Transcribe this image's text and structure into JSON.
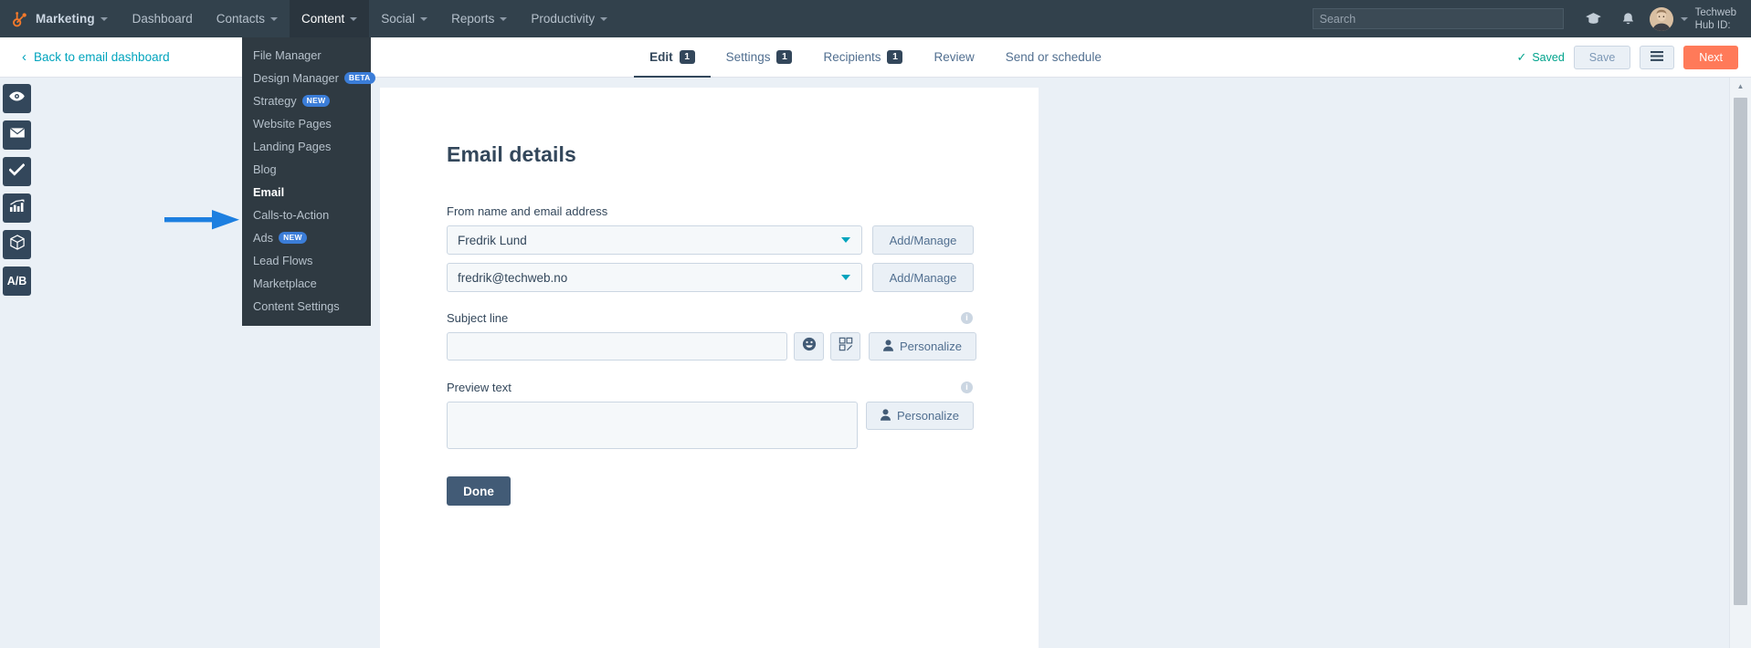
{
  "topnav": {
    "logo_icon": "hubspot-sprocket-icon",
    "logo_label": "Marketing",
    "items": [
      {
        "label": "Dashboard",
        "has_caret": false,
        "active": false
      },
      {
        "label": "Contacts",
        "has_caret": true,
        "active": false
      },
      {
        "label": "Content",
        "has_caret": true,
        "active": true
      },
      {
        "label": "Social",
        "has_caret": true,
        "active": false
      },
      {
        "label": "Reports",
        "has_caret": true,
        "active": false
      },
      {
        "label": "Productivity",
        "has_caret": true,
        "active": false
      }
    ],
    "search": {
      "value": "",
      "placeholder": "Search"
    },
    "icons": [
      "graduation-cap-icon",
      "notification-bell-icon"
    ],
    "account_name": "Techweb",
    "account_hub_label": "Hub ID:"
  },
  "content_dropdown": {
    "open": true,
    "items": [
      {
        "label": "File Manager",
        "badge": "",
        "active": false
      },
      {
        "label": "Design Manager",
        "badge": "BETA",
        "active": false
      },
      {
        "label": "Strategy",
        "badge": "NEW",
        "active": false
      },
      {
        "label": "Website Pages",
        "badge": "",
        "active": false
      },
      {
        "label": "Landing Pages",
        "badge": "",
        "active": false
      },
      {
        "label": "Blog",
        "badge": "",
        "active": false
      },
      {
        "label": "Email",
        "badge": "",
        "active": true
      },
      {
        "label": "Calls-to-Action",
        "badge": "",
        "active": false
      },
      {
        "label": "Ads",
        "badge": "NEW",
        "active": false
      },
      {
        "label": "Lead Flows",
        "badge": "",
        "active": false
      },
      {
        "label": "Marketplace",
        "badge": "",
        "active": false
      },
      {
        "label": "Content Settings",
        "badge": "",
        "active": false
      }
    ]
  },
  "subheader": {
    "back_label": "Back to email dashboard",
    "back_chevron": "‹",
    "tabs": [
      {
        "label": "Edit",
        "badge": "1",
        "active": true
      },
      {
        "label": "Settings",
        "badge": "1",
        "active": false
      },
      {
        "label": "Recipients",
        "badge": "1",
        "active": false
      },
      {
        "label": "Review",
        "badge": "",
        "active": false
      },
      {
        "label": "Send or schedule",
        "badge": "",
        "active": false
      }
    ],
    "saved_status": "Saved",
    "saved_check": "✓",
    "save_label": "Save",
    "menu_icon": "hamburger-menu-icon",
    "next_label": "Next"
  },
  "rail": {
    "items": [
      {
        "icon": "eye-preview-icon",
        "label": ""
      },
      {
        "icon": "envelope-icon",
        "label": ""
      },
      {
        "icon": "checkmark-icon",
        "label": ""
      },
      {
        "icon": "chart-bar-icon",
        "label": ""
      },
      {
        "icon": "cube-box-icon",
        "label": ""
      },
      {
        "icon": "ab-test-icon",
        "label": "A/B"
      }
    ]
  },
  "form": {
    "title": "Email details",
    "from_label": "From name and email address",
    "from_name_value": "Fredrik Lund",
    "from_email_value": "fredrik@techweb.no",
    "add_manage_label": "Add/Manage",
    "subject_label": "Subject line",
    "subject_value": "",
    "subject_placeholder": "",
    "emoji_icon": "smiley-emoji-icon",
    "variant_icon": "ab-variant-icon",
    "personalize_label": "Personalize",
    "personalize_icon": "person-icon",
    "preview_label": "Preview text",
    "preview_value": "",
    "preview_placeholder": "",
    "info_icon": "info-circle-icon",
    "info_glyph": "i",
    "done_label": "Done"
  },
  "scrollbar": {
    "up_arrow": "▲"
  },
  "annotation": {
    "arrow_icon": "blue-pointer-arrow",
    "arrow_color": "#1d7fe0",
    "points_at": "Email"
  },
  "colors": {
    "nav_bg": "#32414c",
    "dropdown_bg": "#2f3a42",
    "accent_orange": "#ff7a59",
    "accent_teal": "#00a4bd",
    "dark_blue": "#33475b",
    "page_bg": "#eaf0f6",
    "badge_blue": "#3b7dd8",
    "green": "#00a38c"
  }
}
